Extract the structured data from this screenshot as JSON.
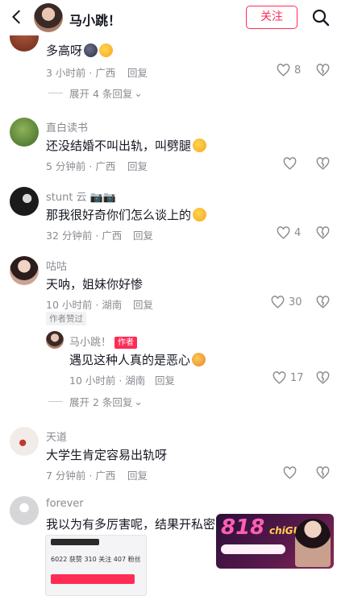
{
  "header": {
    "name": "马小跳！",
    "follow_label": "关注"
  },
  "comments": [
    {
      "text": "多高呀",
      "time": "3 小时前 · 广西",
      "reply": "回复",
      "likes": "8",
      "expand": "展开 4 条回复"
    },
    {
      "user": "直白读书",
      "text": "还没结婚不叫出轨，叫劈腿",
      "time": "5 分钟前 · 广西",
      "reply": "回复"
    },
    {
      "user": "stunt 云",
      "text": "那我很好奇你们怎么谈上的",
      "time": "32 分钟前 · 广西",
      "reply": "回复",
      "likes": "4"
    },
    {
      "user": "咕咕",
      "text": "天呐，姐妹你好惨",
      "time": "10 小时前 · 湖南",
      "reply": "回复",
      "likes": "30",
      "liked_tag": "作者赞过",
      "sub": {
        "user": "马小跳！",
        "author_tag": "作者",
        "text": "遇见这种人真的是恶心",
        "time": "10 小时前 · 湖南",
        "reply": "回复",
        "likes": "17"
      },
      "expand": "展开 2 条回复"
    },
    {
      "user": "天道",
      "text": "大学生肯定容易出轨呀",
      "time": "7 分钟前 · 广西",
      "reply": "回复"
    },
    {
      "user": "forever",
      "text": "我以为有多厉害呢，结果开私密了",
      "shot": {
        "stats": "6022 获赞   310 关注   407 粉丝"
      }
    }
  ],
  "watermark": {
    "num": "818",
    "word": "chiGUA"
  }
}
